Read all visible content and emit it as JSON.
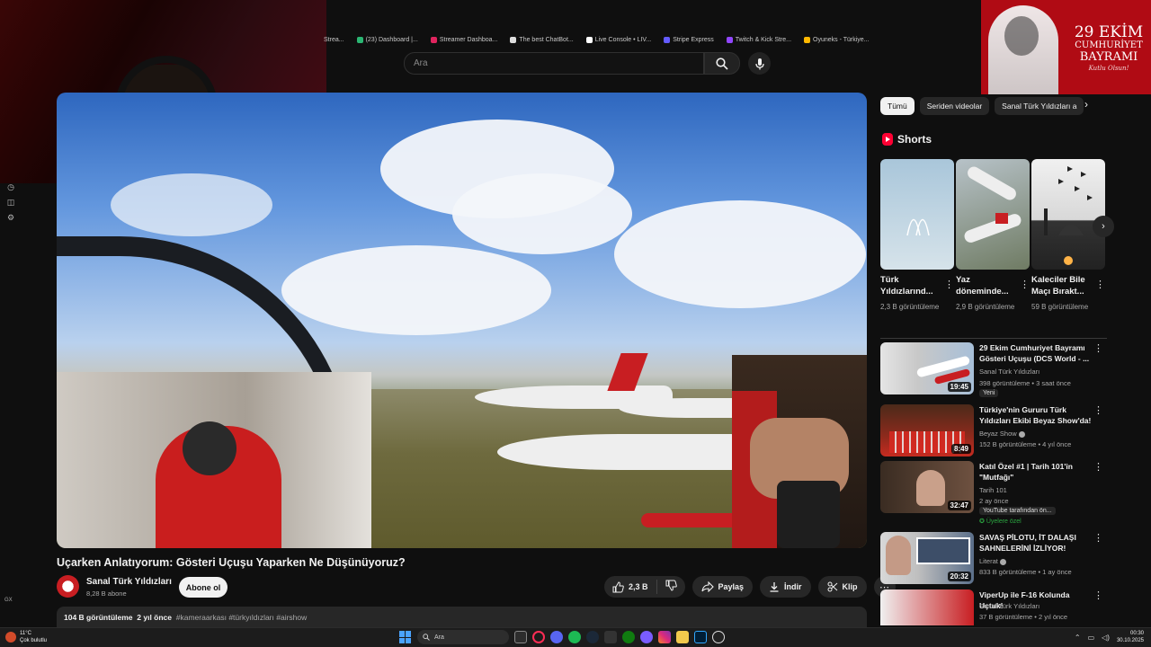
{
  "bookmarks": [
    {
      "label": "Strea..."
    },
    {
      "label": "(23) Dashboard |..."
    },
    {
      "label": "Streamer Dashboa..."
    },
    {
      "label": "The best ChatBot..."
    },
    {
      "label": "Live Console • LIV..."
    },
    {
      "label": "Stripe Express"
    },
    {
      "label": "Twitch & Kick Stre..."
    },
    {
      "label": "Oyuneks - Türkiye..."
    }
  ],
  "search": {
    "placeholder": "Ara"
  },
  "banner": {
    "line1": "29 EKİM",
    "line2": "CUMHURİYET",
    "line3": "BAYRAMI",
    "line4": "Kutlu Olsun!"
  },
  "video": {
    "title": "Uçarken Anlatıyorum: Gösteri Uçuşu Yaparken Ne Düşünüyoruz?",
    "channel": "Sanal Türk Yıldızları",
    "subscribers": "8,28 B abone",
    "subscribe_label": "Abone ol",
    "likes": "2,3 B",
    "share_label": "Paylaş",
    "download_label": "İndir",
    "clip_label": "Klip",
    "views": "104 B görüntüleme",
    "age": "2 yıl önce",
    "tags": "#kameraarkası #türkyıldızları #airshow"
  },
  "chips": [
    {
      "label": "Tümü",
      "active": true
    },
    {
      "label": "Seriden videolar",
      "active": false
    },
    {
      "label": "Sanal Türk Yıldızları a",
      "active": false
    }
  ],
  "shorts": {
    "heading": "Shorts",
    "items": [
      {
        "title": "Türk Yıldızlarınd...",
        "views": "2,3 B görüntüleme"
      },
      {
        "title": "Yaz döneminde...",
        "views": "2,9 B görüntüleme"
      },
      {
        "title": "Kaleciler Bile Maçı Bırakt...",
        "views": "59 B görüntüleme"
      }
    ]
  },
  "recommendations": [
    {
      "title": "29 Ekim Cumhuriyet Bayramı Gösteri Uçuşu (DCS World - ...",
      "channel": "Sanal Türk Yıldızları",
      "meta": "398 görüntüleme • 3 saat önce",
      "badge": "Yeni",
      "duration": "19:45"
    },
    {
      "title": "Türkiye'nin Gururu Türk Yıldızları Ekibi Beyaz Show'da! ...",
      "channel": "Beyaz Show",
      "meta": "152 B görüntüleme • 4 yıl önce",
      "badge": "",
      "duration": "8:49"
    },
    {
      "title": "Katıl Özel #1 | Tarih 101'in \"Mutfağı\"",
      "channel": "Tarih 101",
      "meta": "2 ay önce",
      "badge": "YouTube tarafından ön...",
      "badge2": "Üyelere özel",
      "duration": "32:47"
    },
    {
      "title": "SAVAŞ PİLOTU, İT DALAŞI SAHNELERİNİ İZLİYOR!",
      "channel": "Literat",
      "meta": "833 B görüntüleme • 1 ay önce",
      "badge": "",
      "duration": "20:32"
    },
    {
      "title": "ViperUp ile F-16 Kolunda Uçtuk!",
      "channel": "Sanal Türk Yıldızları",
      "meta": "37 B görüntüleme • 2 yıl önce",
      "badge": "",
      "duration": ""
    }
  ],
  "taskbar": {
    "temp": "11°C",
    "weather": "Çok bulutlu",
    "search": "Ara",
    "time": "00:30",
    "date": "30.10.2025"
  },
  "rail_bottom": "GX",
  "colors": {
    "accent": "#ff0033",
    "bg": "#0f0f0f",
    "chip": "#272727",
    "banner": "#b00b14"
  }
}
